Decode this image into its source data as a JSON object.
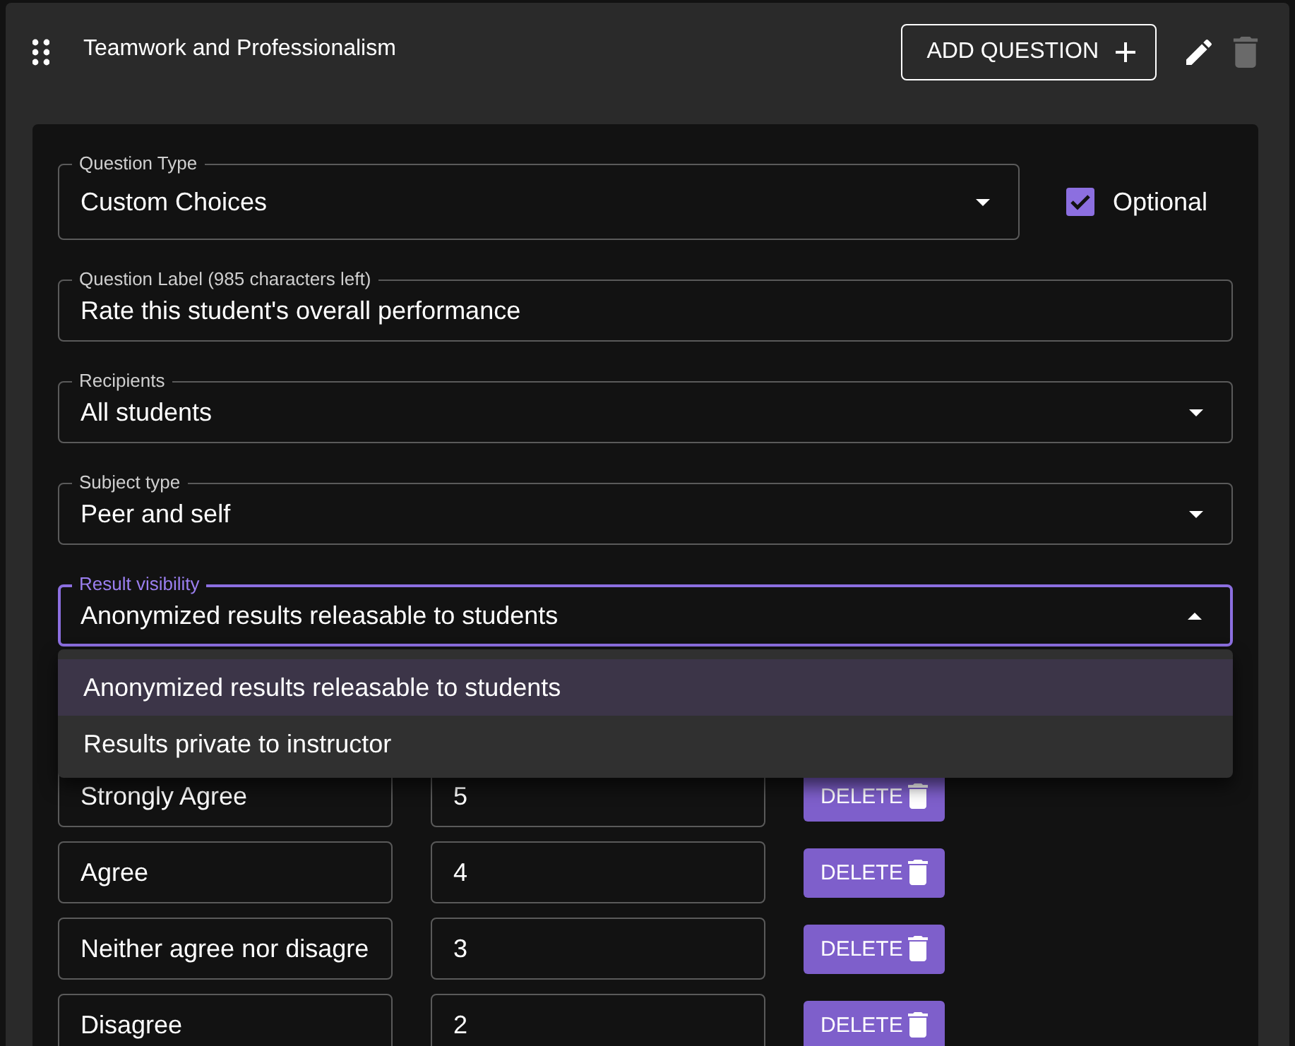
{
  "section": {
    "title": "Teamwork and Professionalism",
    "add_button": "ADD QUESTION"
  },
  "question_type": {
    "label": "Question Type",
    "value": "Custom Choices"
  },
  "optional": {
    "label": "Optional",
    "checked": true
  },
  "fields": [
    {
      "kind": "text",
      "label": "Question Label (985 characters left)",
      "value": "Rate this student's overall performance",
      "expanded": false
    },
    {
      "kind": "select",
      "label": "Recipients",
      "value": "All students",
      "expanded": false
    },
    {
      "kind": "select",
      "label": "Subject type",
      "value": "Peer and self",
      "expanded": false
    },
    {
      "kind": "select",
      "label": "Result visibility",
      "value": "Anonymized results releasable to students",
      "expanded": true,
      "options": [
        {
          "label": "Anonymized results releasable to students",
          "selected": true
        },
        {
          "label": "Results private to instructor",
          "selected": false
        }
      ]
    }
  ],
  "choices": [
    {
      "label": "Strongly Agree",
      "value": "5",
      "button": "DELETE"
    },
    {
      "label": "Agree",
      "value": "4",
      "button": "DELETE"
    },
    {
      "label": "Neither agree nor disagre",
      "value": "3",
      "button": "DELETE"
    },
    {
      "label": "Disagree",
      "value": "2",
      "button": "DELETE"
    }
  ]
}
